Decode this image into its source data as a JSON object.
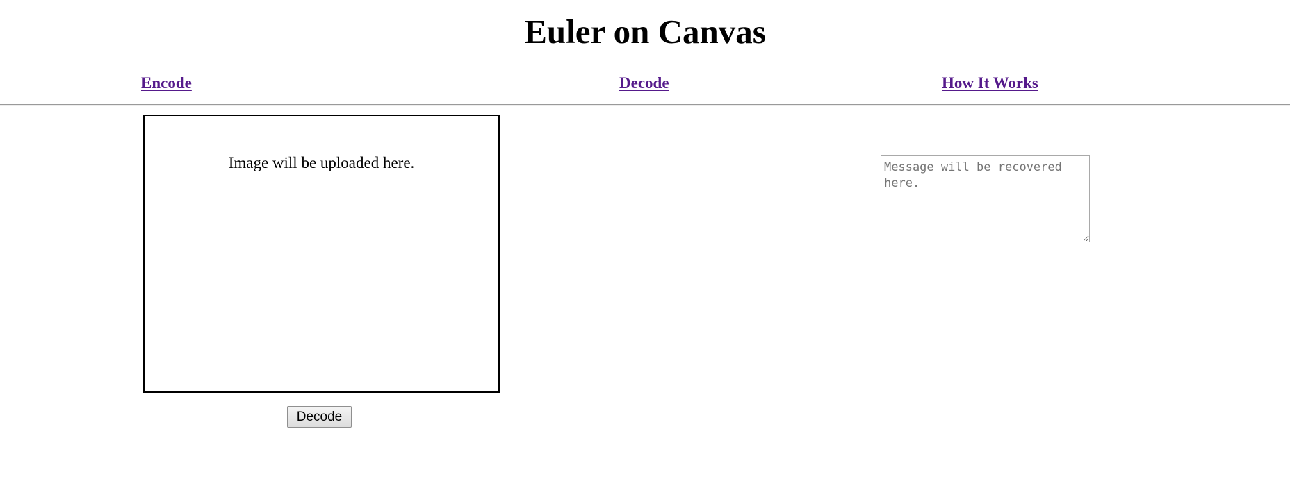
{
  "page": {
    "title": "Euler on Canvas"
  },
  "nav": {
    "links": [
      {
        "label": "Encode"
      },
      {
        "label": "Decode"
      },
      {
        "label": "How It Works"
      }
    ],
    "link_color": "#551a8b"
  },
  "upload_area": {
    "text": "Image will be uploaded here."
  },
  "actions": {
    "decode_label": "Decode"
  },
  "message": {
    "value": "",
    "placeholder": "Message will be recovered here."
  }
}
